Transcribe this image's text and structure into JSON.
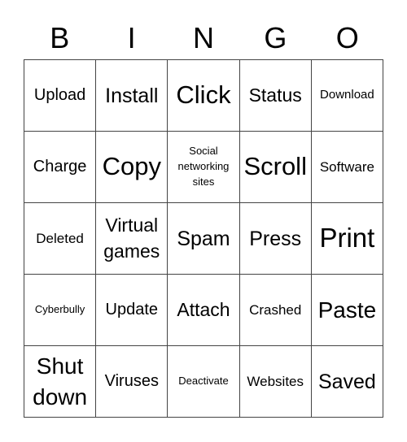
{
  "header": [
    "B",
    "I",
    "N",
    "G",
    "O"
  ],
  "cells": [
    "Upload",
    "Install",
    "Click",
    "Status",
    "Download",
    "Charge",
    "Copy",
    "Social networking sites",
    "Scroll",
    "Software",
    "Deleted",
    "Virtual games",
    "Spam",
    "Press",
    "Print",
    "Cyberbully",
    "Update",
    "Attach",
    "Crashed",
    "Paste",
    "Shut down",
    "Viruses",
    "Deactivate",
    "Websites",
    "Saved"
  ]
}
